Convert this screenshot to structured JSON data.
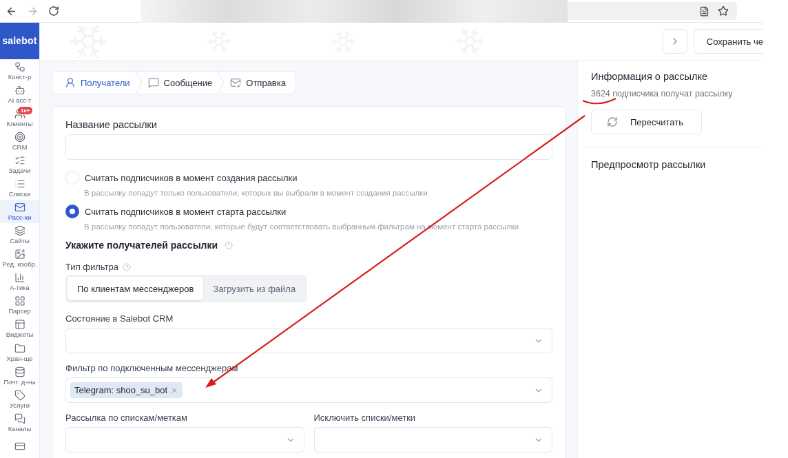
{
  "sidebar": {
    "logo": "salebot",
    "items": [
      {
        "label": "Конст-р",
        "selected": false
      },
      {
        "label": "AI асс-т",
        "selected": false
      },
      {
        "label": "Клиенты",
        "selected": false,
        "badge": "1к+"
      },
      {
        "label": "CRM",
        "selected": false
      },
      {
        "label": "Задачи",
        "selected": false
      },
      {
        "label": "Списки",
        "selected": false
      },
      {
        "label": "Расс-ки",
        "selected": true
      },
      {
        "label": "Сайты",
        "selected": false
      },
      {
        "label": "Ред. изобр.",
        "selected": false
      },
      {
        "label": "А-тика",
        "selected": false
      },
      {
        "label": "Парсер",
        "selected": false
      },
      {
        "label": "Виджеты",
        "selected": false
      },
      {
        "label": "Хран-ще",
        "selected": false
      },
      {
        "label": "Почт. д-ны",
        "selected": false
      },
      {
        "label": "Услуги",
        "selected": false
      },
      {
        "label": "Каналы",
        "selected": false
      }
    ]
  },
  "header": {
    "save_button": "Сохранить че"
  },
  "steps": [
    {
      "label": "Получатели",
      "selected": true
    },
    {
      "label": "Сообщение",
      "selected": false
    },
    {
      "label": "Отправка",
      "selected": false
    }
  ],
  "form": {
    "name_label": "Название рассылки",
    "radios": [
      {
        "label": "Считать подписчиков в момент создания рассылки",
        "hint": "В рассылку попадут только пользователи, которых вы выбрали в момент создания рассылки",
        "selected": false
      },
      {
        "label": "Считать подписчиков в момент старта рассылки",
        "hint": "В рассылку попадут пользователи, которые будут соответствовать выбранным фильтрам на момент старта рассылки",
        "selected": true
      }
    ],
    "recipients_heading": "Укажите получателей рассылки",
    "filter_type_label": "Тип фильтра",
    "filter_tabs": [
      {
        "label": "По клиентам мессенджеров",
        "selected": true
      },
      {
        "label": "Загрузить из файла",
        "selected": false
      }
    ],
    "crm_state_label": "Состояние в Salebot CRM",
    "messengers_label": "Фильтр по подключенным мессенджерам",
    "messenger_tags": [
      "Telegram: shoo_su_bot"
    ],
    "lists_label": "Рассылка по спискам/меткам",
    "exclude_label": "Исключить списки/метки"
  },
  "info": {
    "title": "Информация о рассылке",
    "subscribers": "3624 подписчика получат рассылку",
    "recalc_button": "Пересчитать"
  },
  "preview": {
    "title": "Предпросмотр рассылки"
  }
}
